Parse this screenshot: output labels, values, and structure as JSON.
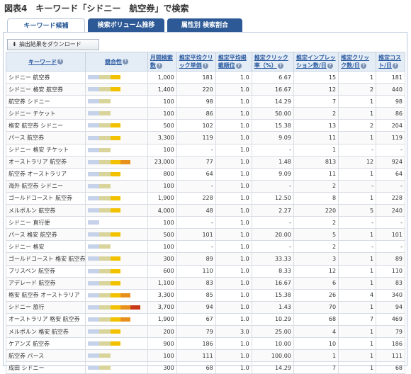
{
  "page": {
    "title": "図表4　キーワード「シドニー　航空券」で検索"
  },
  "tabs": [
    {
      "label": "キーワード候補",
      "active": true
    },
    {
      "label": "検索ボリューム推移",
      "active": false
    },
    {
      "label": "属性別 検索割合",
      "active": false
    }
  ],
  "toolbar": {
    "download_label": "抽出結果をダウンロード",
    "download_icon": "download-arrow-icon"
  },
  "table": {
    "headers": {
      "keyword": "キーワード",
      "competition": "競合性",
      "monthly": "月間検索数",
      "cpc": "推定平均クリック単価",
      "position": "推定平均掲載順位",
      "ctr": "推定クリック率（%）",
      "impressions": "推定インプレッション数/日",
      "clicks": "推定クリック数/日",
      "cost": "推定コスト/日"
    },
    "competition_colors": [
      "#c6d2ea",
      "#d8d49a",
      "#f2c200",
      "#e8901e",
      "#c83818"
    ],
    "rows": [
      {
        "keyword": "シドニー 航空券",
        "competition": 3,
        "monthly": "1,000",
        "cpc": "181",
        "position": "1.0",
        "ctr": "6.67",
        "impressions": "15",
        "clicks": "1",
        "cost": "181"
      },
      {
        "keyword": "シドニー 格安 航空券",
        "competition": 3,
        "monthly": "1,400",
        "cpc": "220",
        "position": "1.0",
        "ctr": "16.67",
        "impressions": "12",
        "clicks": "2",
        "cost": "440"
      },
      {
        "keyword": "航空券 シドニー",
        "competition": 2,
        "monthly": "100",
        "cpc": "98",
        "position": "1.0",
        "ctr": "14.29",
        "impressions": "7",
        "clicks": "1",
        "cost": "98"
      },
      {
        "keyword": "シドニー チケット",
        "competition": 2,
        "monthly": "100",
        "cpc": "86",
        "position": "1.0",
        "ctr": "50.00",
        "impressions": "2",
        "clicks": "1",
        "cost": "86"
      },
      {
        "keyword": "格安 航空券 シドニー",
        "competition": 3,
        "monthly": "500",
        "cpc": "102",
        "position": "1.0",
        "ctr": "15.38",
        "impressions": "13",
        "clicks": "2",
        "cost": "204"
      },
      {
        "keyword": "パース 航空券",
        "competition": 3,
        "monthly": "3,300",
        "cpc": "119",
        "position": "1.0",
        "ctr": "9.09",
        "impressions": "11",
        "clicks": "1",
        "cost": "119"
      },
      {
        "keyword": "シドニー 格安 チケット",
        "competition": 2,
        "monthly": "100",
        "cpc": "-",
        "position": "1.0",
        "ctr": "-",
        "impressions": "1",
        "clicks": "-",
        "cost": "-"
      },
      {
        "keyword": "オーストラリア 航空券",
        "competition": 4,
        "monthly": "23,000",
        "cpc": "77",
        "position": "1.0",
        "ctr": "1.48",
        "impressions": "813",
        "clicks": "12",
        "cost": "924"
      },
      {
        "keyword": "航空券 オーストラリア",
        "competition": 3,
        "monthly": "800",
        "cpc": "64",
        "position": "1.0",
        "ctr": "9.09",
        "impressions": "11",
        "clicks": "1",
        "cost": "64"
      },
      {
        "keyword": "海外 航空券 シドニー",
        "competition": 2,
        "monthly": "100",
        "cpc": "-",
        "position": "1.0",
        "ctr": "-",
        "impressions": "2",
        "clicks": "-",
        "cost": "-"
      },
      {
        "keyword": "ゴールドコースト 航空券",
        "competition": 3,
        "monthly": "1,900",
        "cpc": "228",
        "position": "1.0",
        "ctr": "12.50",
        "impressions": "8",
        "clicks": "1",
        "cost": "228"
      },
      {
        "keyword": "メルボルン 航空券",
        "competition": 3,
        "monthly": "4,000",
        "cpc": "48",
        "position": "1.0",
        "ctr": "2.27",
        "impressions": "220",
        "clicks": "5",
        "cost": "240"
      },
      {
        "keyword": "シドニー 直行便",
        "competition": 1,
        "monthly": "100",
        "cpc": "-",
        "position": "1.0",
        "ctr": "-",
        "impressions": "2",
        "clicks": "-",
        "cost": "-"
      },
      {
        "keyword": "パース 格安 航空券",
        "competition": 3,
        "monthly": "500",
        "cpc": "101",
        "position": "1.0",
        "ctr": "20.00",
        "impressions": "5",
        "clicks": "1",
        "cost": "101"
      },
      {
        "keyword": "シドニー 格安",
        "competition": 2,
        "monthly": "100",
        "cpc": "-",
        "position": "1.0",
        "ctr": "-",
        "impressions": "2",
        "clicks": "-",
        "cost": "-"
      },
      {
        "keyword": "ゴールドコースト 格安 航空券",
        "competition": 3,
        "monthly": "300",
        "cpc": "89",
        "position": "1.0",
        "ctr": "33.33",
        "impressions": "3",
        "clicks": "1",
        "cost": "89"
      },
      {
        "keyword": "ブリスベン 航空券",
        "competition": 3,
        "monthly": "600",
        "cpc": "110",
        "position": "1.0",
        "ctr": "8.33",
        "impressions": "12",
        "clicks": "1",
        "cost": "110"
      },
      {
        "keyword": "アデレード 航空券",
        "competition": 3,
        "monthly": "1,100",
        "cpc": "83",
        "position": "1.0",
        "ctr": "16.67",
        "impressions": "6",
        "clicks": "1",
        "cost": "83"
      },
      {
        "keyword": "格安 航空券 オーストラリア",
        "competition": 4,
        "monthly": "3,300",
        "cpc": "85",
        "position": "1.0",
        "ctr": "15.38",
        "impressions": "26",
        "clicks": "4",
        "cost": "340"
      },
      {
        "keyword": "シドニー 旅行",
        "competition": 5,
        "monthly": "3,700",
        "cpc": "94",
        "position": "1.0",
        "ctr": "1.43",
        "impressions": "70",
        "clicks": "1",
        "cost": "94"
      },
      {
        "keyword": "オーストラリア 格安 航空券",
        "competition": 4,
        "monthly": "1,900",
        "cpc": "67",
        "position": "1.0",
        "ctr": "10.29",
        "impressions": "68",
        "clicks": "7",
        "cost": "469"
      },
      {
        "keyword": "メルボルン 格安 航空券",
        "competition": 3,
        "monthly": "200",
        "cpc": "79",
        "position": "3.0",
        "ctr": "25.00",
        "impressions": "4",
        "clicks": "1",
        "cost": "79"
      },
      {
        "keyword": "ケアンズ 航空券",
        "competition": 3,
        "monthly": "900",
        "cpc": "186",
        "position": "1.0",
        "ctr": "10.00",
        "impressions": "10",
        "clicks": "1",
        "cost": "186"
      },
      {
        "keyword": "航空券 パース",
        "competition": 2,
        "monthly": "100",
        "cpc": "111",
        "position": "1.0",
        "ctr": "100.00",
        "impressions": "1",
        "clicks": "1",
        "cost": "111"
      },
      {
        "keyword": "成田 シドニー",
        "competition": 2,
        "monthly": "300",
        "cpc": "68",
        "position": "1.0",
        "ctr": "14.29",
        "impressions": "7",
        "clicks": "1",
        "cost": "68"
      }
    ]
  }
}
